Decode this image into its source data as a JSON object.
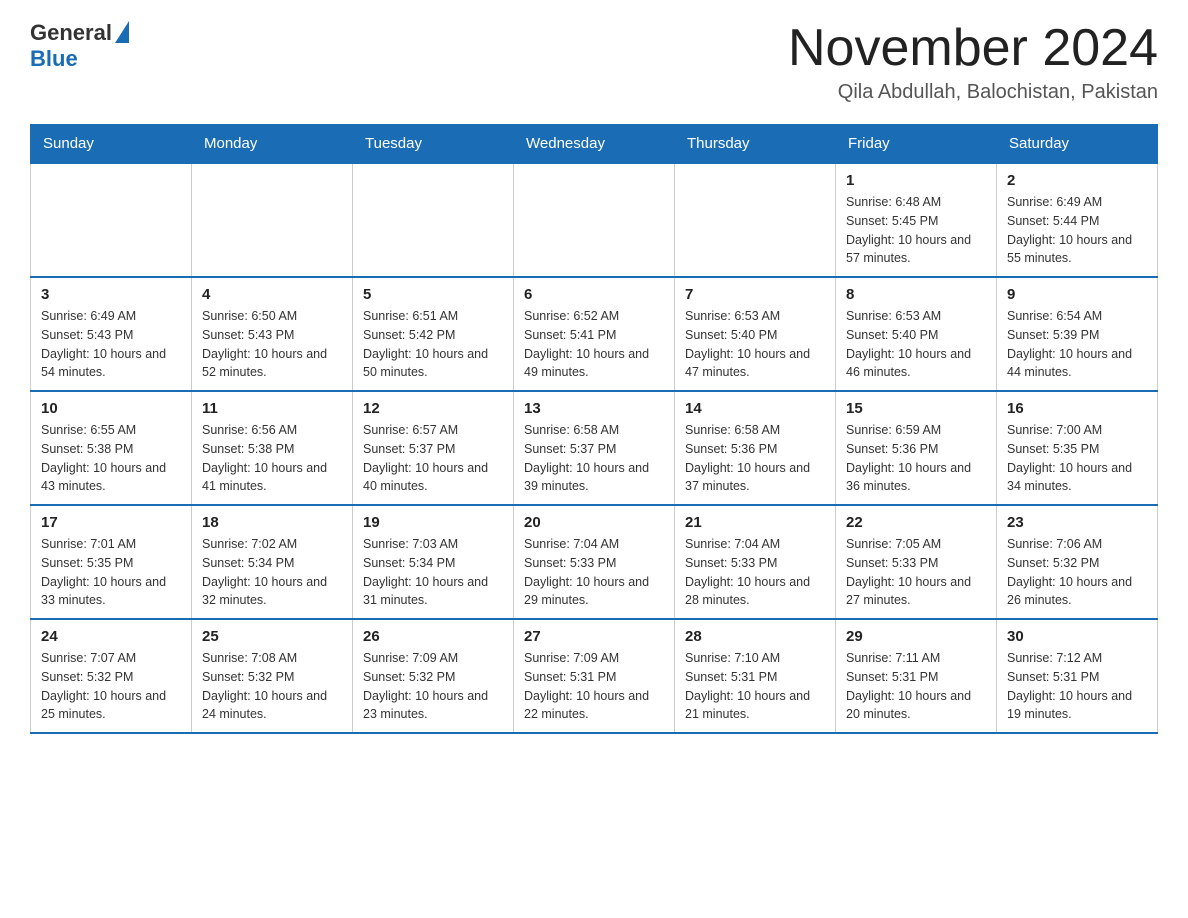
{
  "header": {
    "logo_general": "General",
    "logo_blue": "Blue",
    "title": "November 2024",
    "subtitle": "Qila Abdullah, Balochistan, Pakistan"
  },
  "calendar": {
    "days_of_week": [
      "Sunday",
      "Monday",
      "Tuesday",
      "Wednesday",
      "Thursday",
      "Friday",
      "Saturday"
    ],
    "weeks": [
      {
        "cells": [
          {
            "day": "",
            "info": ""
          },
          {
            "day": "",
            "info": ""
          },
          {
            "day": "",
            "info": ""
          },
          {
            "day": "",
            "info": ""
          },
          {
            "day": "",
            "info": ""
          },
          {
            "day": "1",
            "info": "Sunrise: 6:48 AM\nSunset: 5:45 PM\nDaylight: 10 hours and 57 minutes."
          },
          {
            "day": "2",
            "info": "Sunrise: 6:49 AM\nSunset: 5:44 PM\nDaylight: 10 hours and 55 minutes."
          }
        ]
      },
      {
        "cells": [
          {
            "day": "3",
            "info": "Sunrise: 6:49 AM\nSunset: 5:43 PM\nDaylight: 10 hours and 54 minutes."
          },
          {
            "day": "4",
            "info": "Sunrise: 6:50 AM\nSunset: 5:43 PM\nDaylight: 10 hours and 52 minutes."
          },
          {
            "day": "5",
            "info": "Sunrise: 6:51 AM\nSunset: 5:42 PM\nDaylight: 10 hours and 50 minutes."
          },
          {
            "day": "6",
            "info": "Sunrise: 6:52 AM\nSunset: 5:41 PM\nDaylight: 10 hours and 49 minutes."
          },
          {
            "day": "7",
            "info": "Sunrise: 6:53 AM\nSunset: 5:40 PM\nDaylight: 10 hours and 47 minutes."
          },
          {
            "day": "8",
            "info": "Sunrise: 6:53 AM\nSunset: 5:40 PM\nDaylight: 10 hours and 46 minutes."
          },
          {
            "day": "9",
            "info": "Sunrise: 6:54 AM\nSunset: 5:39 PM\nDaylight: 10 hours and 44 minutes."
          }
        ]
      },
      {
        "cells": [
          {
            "day": "10",
            "info": "Sunrise: 6:55 AM\nSunset: 5:38 PM\nDaylight: 10 hours and 43 minutes."
          },
          {
            "day": "11",
            "info": "Sunrise: 6:56 AM\nSunset: 5:38 PM\nDaylight: 10 hours and 41 minutes."
          },
          {
            "day": "12",
            "info": "Sunrise: 6:57 AM\nSunset: 5:37 PM\nDaylight: 10 hours and 40 minutes."
          },
          {
            "day": "13",
            "info": "Sunrise: 6:58 AM\nSunset: 5:37 PM\nDaylight: 10 hours and 39 minutes."
          },
          {
            "day": "14",
            "info": "Sunrise: 6:58 AM\nSunset: 5:36 PM\nDaylight: 10 hours and 37 minutes."
          },
          {
            "day": "15",
            "info": "Sunrise: 6:59 AM\nSunset: 5:36 PM\nDaylight: 10 hours and 36 minutes."
          },
          {
            "day": "16",
            "info": "Sunrise: 7:00 AM\nSunset: 5:35 PM\nDaylight: 10 hours and 34 minutes."
          }
        ]
      },
      {
        "cells": [
          {
            "day": "17",
            "info": "Sunrise: 7:01 AM\nSunset: 5:35 PM\nDaylight: 10 hours and 33 minutes."
          },
          {
            "day": "18",
            "info": "Sunrise: 7:02 AM\nSunset: 5:34 PM\nDaylight: 10 hours and 32 minutes."
          },
          {
            "day": "19",
            "info": "Sunrise: 7:03 AM\nSunset: 5:34 PM\nDaylight: 10 hours and 31 minutes."
          },
          {
            "day": "20",
            "info": "Sunrise: 7:04 AM\nSunset: 5:33 PM\nDaylight: 10 hours and 29 minutes."
          },
          {
            "day": "21",
            "info": "Sunrise: 7:04 AM\nSunset: 5:33 PM\nDaylight: 10 hours and 28 minutes."
          },
          {
            "day": "22",
            "info": "Sunrise: 7:05 AM\nSunset: 5:33 PM\nDaylight: 10 hours and 27 minutes."
          },
          {
            "day": "23",
            "info": "Sunrise: 7:06 AM\nSunset: 5:32 PM\nDaylight: 10 hours and 26 minutes."
          }
        ]
      },
      {
        "cells": [
          {
            "day": "24",
            "info": "Sunrise: 7:07 AM\nSunset: 5:32 PM\nDaylight: 10 hours and 25 minutes."
          },
          {
            "day": "25",
            "info": "Sunrise: 7:08 AM\nSunset: 5:32 PM\nDaylight: 10 hours and 24 minutes."
          },
          {
            "day": "26",
            "info": "Sunrise: 7:09 AM\nSunset: 5:32 PM\nDaylight: 10 hours and 23 minutes."
          },
          {
            "day": "27",
            "info": "Sunrise: 7:09 AM\nSunset: 5:31 PM\nDaylight: 10 hours and 22 minutes."
          },
          {
            "day": "28",
            "info": "Sunrise: 7:10 AM\nSunset: 5:31 PM\nDaylight: 10 hours and 21 minutes."
          },
          {
            "day": "29",
            "info": "Sunrise: 7:11 AM\nSunset: 5:31 PM\nDaylight: 10 hours and 20 minutes."
          },
          {
            "day": "30",
            "info": "Sunrise: 7:12 AM\nSunset: 5:31 PM\nDaylight: 10 hours and 19 minutes."
          }
        ]
      }
    ]
  }
}
